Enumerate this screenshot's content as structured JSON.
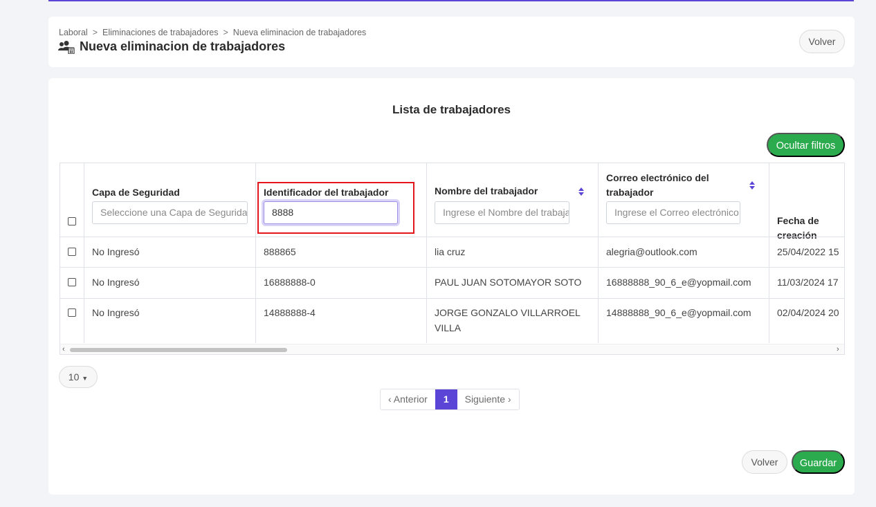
{
  "breadcrumb": [
    "Laboral",
    "Eliminaciones de trabajadores",
    "Nueva eliminacion de trabajadores"
  ],
  "breadcrumb_separator": ">",
  "page": {
    "title": "Nueva eliminacion de trabajadores",
    "back_label": "Volver"
  },
  "list": {
    "title": "Lista de trabajadores",
    "toggle_filters_label": "Ocultar filtros"
  },
  "table": {
    "columns": [
      {
        "header": "Capa de Seguridad",
        "filter_placeholder": "Seleccione una Capa de Seguridad"
      },
      {
        "header": "Identificador del trabajador",
        "filter_value": "8888"
      },
      {
        "header": "Nombre del trabajador",
        "filter_placeholder": "Ingrese el Nombre del trabajador"
      },
      {
        "header": "Correo electrónico del trabajador",
        "filter_placeholder": "Ingrese el Correo electrónico"
      },
      {
        "header": "Fecha de creación"
      }
    ],
    "rows": [
      {
        "capa": "No Ingresó",
        "id": "888865",
        "nombre": "lia cruz",
        "correo": "alegria@outlook.com",
        "fecha": "25/04/2022 15"
      },
      {
        "capa": "No Ingresó",
        "id": "16888888-0",
        "nombre": "PAUL JUAN SOTOMAYOR SOTO",
        "correo": "16888888_90_6_e@yopmail.com",
        "fecha": "11/03/2024 17"
      },
      {
        "capa": "No Ingresó",
        "id": "14888888-4",
        "nombre_line1": "JORGE GONZALO VILLARROEL",
        "nombre_line2": "VILLA",
        "correo": "14888888_90_6_e@yopmail.com",
        "fecha": "02/04/2024 20"
      }
    ]
  },
  "page_size": {
    "value": "10"
  },
  "pagination": {
    "prev": "‹ Anterior",
    "current": "1",
    "next": "Siguiente ›"
  },
  "footer": {
    "back_label": "Volver",
    "save_label": "Guardar"
  },
  "colors": {
    "accent": "#5a45d6",
    "success": "#2cab4e",
    "highlight": "#e3161b"
  }
}
